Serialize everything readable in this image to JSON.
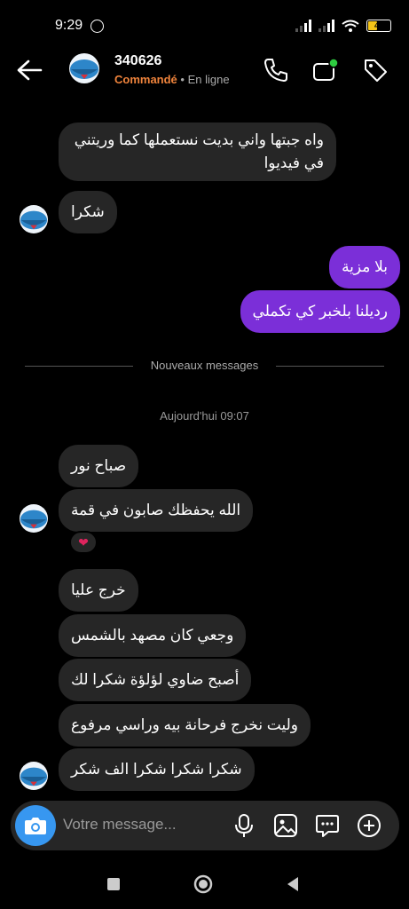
{
  "status_bar": {
    "time": "9:29",
    "battery": "40"
  },
  "header": {
    "name": "340626",
    "ordered": "Commandé",
    "separator": " • ",
    "presence": "En ligne",
    "icons": [
      "back-arrow-icon",
      "phone-icon",
      "video-call-icon",
      "tag-icon"
    ]
  },
  "messages_before": [
    {
      "id": "m1",
      "direction": "in",
      "text": "واه جبتها واني بديت نستعملها  كما وريتني في فيديوا"
    },
    {
      "id": "m2",
      "direction": "in",
      "text": "شكرا"
    },
    {
      "id": "m3",
      "direction": "out",
      "text": "بلا مزية"
    },
    {
      "id": "m4",
      "direction": "out",
      "text": "رديلنا بلخبر كي تكملي"
    }
  ],
  "divider_label": "Nouveaux messages",
  "timestamp": "Aujourd'hui 09:07",
  "messages_after": [
    {
      "id": "m5",
      "direction": "in",
      "text": "صباح نور"
    },
    {
      "id": "m6",
      "direction": "in",
      "text": "الله يحفظك صابون في قمة",
      "reaction": "❤"
    },
    {
      "id": "m7",
      "direction": "in",
      "text": "خرج عليا"
    },
    {
      "id": "m8",
      "direction": "in",
      "text": "وجعي كان مصهد بالشمس"
    },
    {
      "id": "m9",
      "direction": "in",
      "text": "أصبح ضاوي لؤلؤة شكرا  لك"
    },
    {
      "id": "m10",
      "direction": "in",
      "text": "وليت نخرج فرحانة بيه وراسي مرفوع"
    },
    {
      "id": "m11",
      "direction": "in",
      "text": "شكرا شكرا شكرا الف شكر"
    }
  ],
  "composer": {
    "placeholder": "Votre message...",
    "icons": [
      "camera-icon",
      "microphone-icon",
      "gallery-icon",
      "sticker-icon",
      "add-icon"
    ]
  },
  "colors": {
    "background": "#000000",
    "incoming_bubble": "#262626",
    "outgoing_bubble": "#7b2fd8",
    "ordered": "#f0843c",
    "presence_dot": "#2ecc40",
    "camera_button": "#3797f0",
    "reaction": "#e0245e"
  }
}
